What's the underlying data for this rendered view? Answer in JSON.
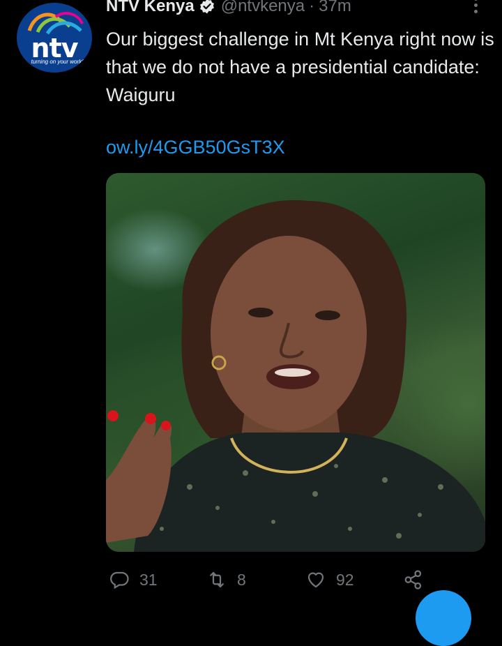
{
  "author": {
    "display_name": "NTV Kenya",
    "handle": "@ntvkenya",
    "separator": "·",
    "time": "37m",
    "avatar": {
      "logo_text": "ntv",
      "tagline": "turning on your world"
    },
    "verified_icon": "verified-badge-icon"
  },
  "tweet": {
    "text": "Our biggest challenge in Mt Kenya right now is that we do not have a presidential candidate: Waiguru",
    "link": "ow.ly/4GGB50GsT3X"
  },
  "actions": {
    "reply_count": "31",
    "retweet_count": "8",
    "like_count": "92",
    "icons": [
      "reply-icon",
      "retweet-icon",
      "like-icon",
      "share-icon"
    ]
  },
  "colors": {
    "background": "#000000",
    "text": "#e7e9ea",
    "muted": "#71767b",
    "link": "#1d9bf0"
  }
}
